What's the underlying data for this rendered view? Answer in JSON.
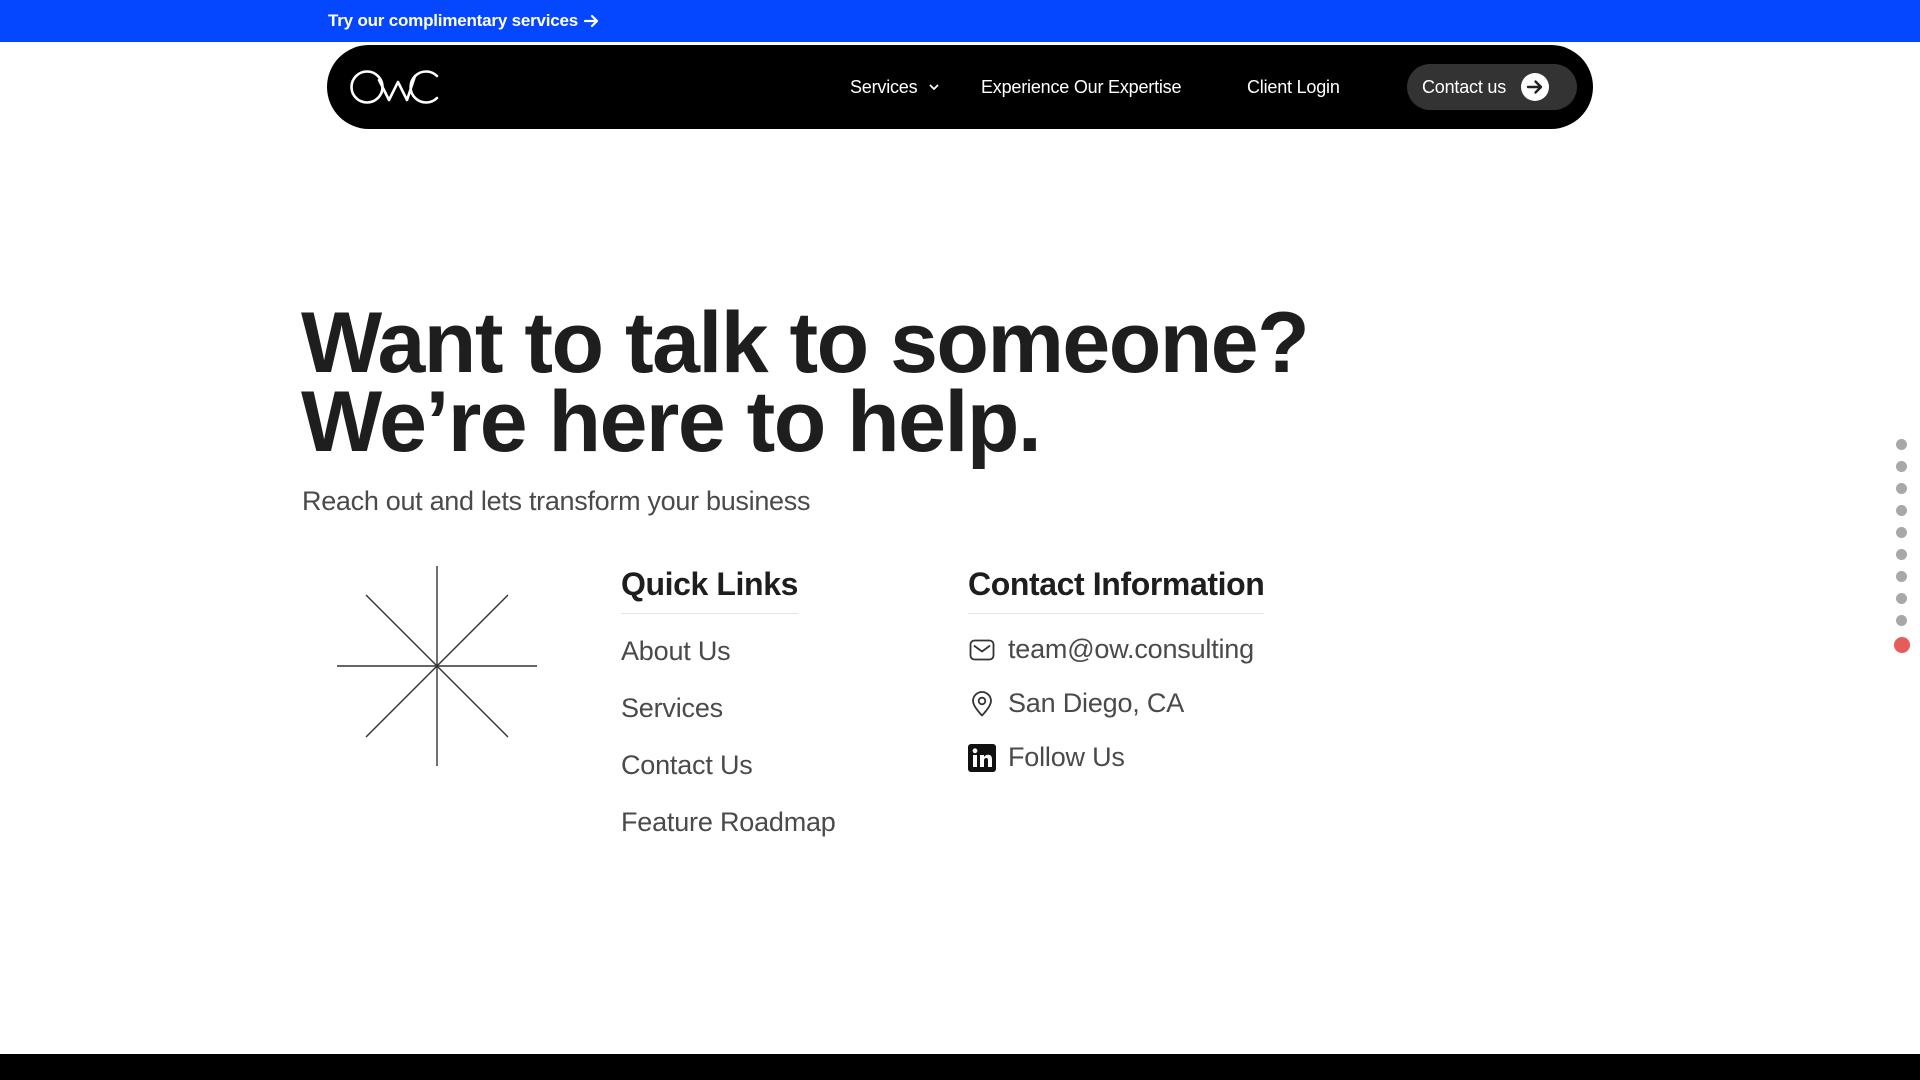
{
  "promo": {
    "text": "Try our complimentary services",
    "bg_color": "#0546ff"
  },
  "nav": {
    "logo_text": "OWC",
    "items": [
      {
        "label": "Services",
        "has_dropdown": true
      },
      {
        "label": "Experience Our Expertise"
      },
      {
        "label": "Client Login"
      }
    ],
    "cta_label": "Contact us"
  },
  "hero": {
    "title_line1": "Want to talk to someone?",
    "title_line2": "We’re here to help.",
    "subtitle": "Reach out and lets transform your business"
  },
  "quick_links": {
    "title": "Quick Links",
    "items": [
      "About Us",
      "Services",
      "Contact Us",
      "Feature Roadmap"
    ]
  },
  "contact_info": {
    "title": "Contact Information",
    "email": "team@ow.consulting",
    "location": "San Diego, CA",
    "social": "Follow Us",
    "icons": [
      "mail-icon",
      "location-pin-icon",
      "linkedin-icon"
    ]
  },
  "dot_nav": {
    "count": 10,
    "active_index": 9,
    "inactive_color": "#a8a8a8",
    "active_color": "#e85b5b"
  }
}
